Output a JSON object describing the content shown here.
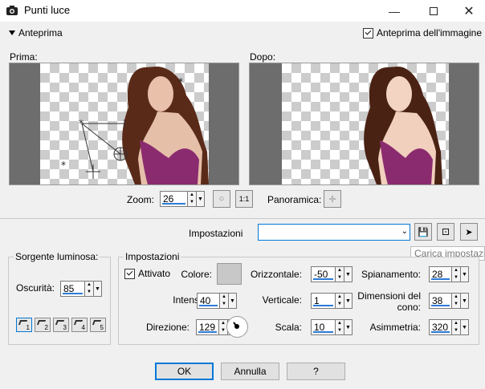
{
  "window": {
    "title": "Punti luce"
  },
  "toolbar": {
    "preview_toggle_label": "Anteprima",
    "image_preview_label": "Anteprima dell'immagine",
    "image_preview_checked": true
  },
  "preview": {
    "before_label": "Prima:",
    "after_label": "Dopo:"
  },
  "zoom": {
    "label": "Zoom:",
    "value": "26"
  },
  "pan": {
    "label": "Panoramica:"
  },
  "presets": {
    "label": "Impostazioni",
    "value": "",
    "tooltip": "Carica impostazi"
  },
  "light_source": {
    "title": "Sorgente luminosa:",
    "darkness_label": "Oscurità:",
    "darkness_value": "85",
    "slots": [
      "1",
      "2",
      "3",
      "4",
      "5"
    ]
  },
  "settings": {
    "title": "Impostazioni",
    "active_label": "Attivato",
    "active_checked": true,
    "color_label": "Colore:",
    "color_value": "#c8c8c8",
    "intensity_label": "Intensità:",
    "intensity_value": "40",
    "direction_label": "Direzione:",
    "direction_value": "129",
    "horizontal_label": "Orizzontale:",
    "horizontal_value": "-50",
    "vertical_label": "Verticale:",
    "vertical_value": "1",
    "scale_label": "Scala:",
    "scale_value": "10",
    "spread_label": "Spianamento:",
    "spread_value": "28",
    "cone_label": "Dimensioni del cono:",
    "cone_value": "38",
    "asymmetry_label": "Asimmetria:",
    "asymmetry_value": "320"
  },
  "footer": {
    "ok_label": "OK",
    "cancel_label": "Annulla",
    "help_label": "?"
  }
}
